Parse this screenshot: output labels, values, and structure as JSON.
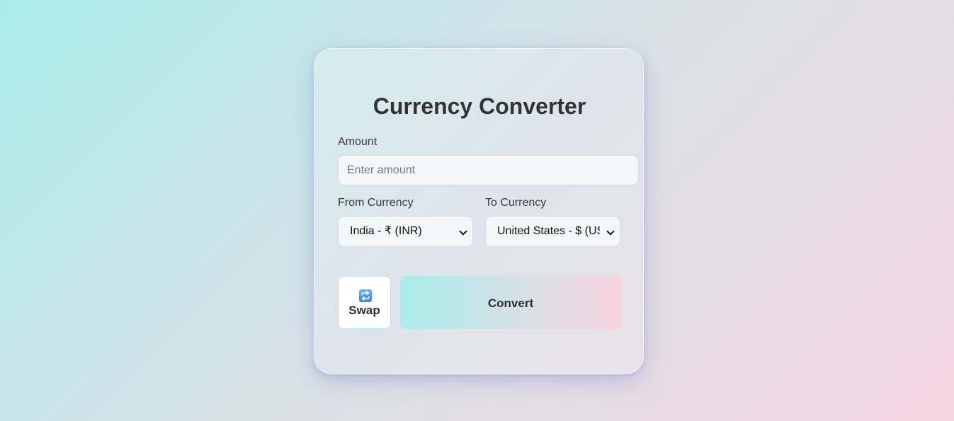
{
  "converter": {
    "title": "Currency Converter",
    "amount_label": "Amount",
    "amount_placeholder": "Enter amount",
    "amount_value": "",
    "from_label": "From Currency",
    "from_selected": "India - ₹ (INR)",
    "to_label": "To Currency",
    "to_selected": "United States - $ (USD)",
    "swap_label": "Swap",
    "swap_icon": "swap-arrows-icon",
    "convert_label": "Convert"
  },
  "colors": {
    "background_start": "#a8ece9",
    "background_end": "#f6d5e1",
    "title_text": "#333333",
    "swap_icon": "#4a90e2",
    "convert_gradient_start": "#a8ece9",
    "convert_gradient_end": "#f8d3df"
  }
}
